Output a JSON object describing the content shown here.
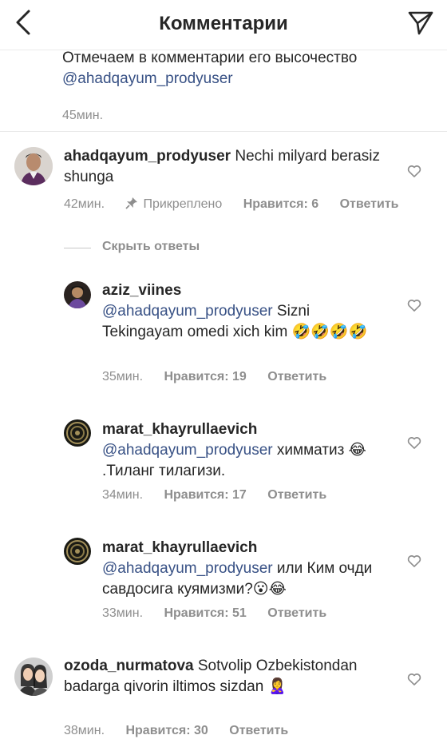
{
  "header": {
    "title": "Комментарии"
  },
  "caption": {
    "text": "Отмечаем в комментарии его высочество",
    "mention": "@ahadqayum_prodyuser",
    "time": "45мин."
  },
  "comments": [
    {
      "username": "ahadqayum_prodyuser",
      "text": " Nechi milyard berasiz shunga",
      "time": "42мин.",
      "pinned": "Прикреплено",
      "likes": "Нравится: 6",
      "reply": "Ответить"
    },
    {
      "username": "ozoda_nurmatova",
      "text": " Sotvolip Ozbekistondan badarga qivorin iltimos sizdan 🙎‍♀️",
      "time": "38мин.",
      "likes": "Нравится: 30",
      "reply": "Ответить"
    }
  ],
  "hide_replies": "Скрыть ответы",
  "replies": [
    {
      "username": "aziz_viines",
      "mention": "@ahadqayum_prodyuser",
      "text": " Sizni Tekingayam omedi xich kim 🤣🤣🤣🤣",
      "time": "35мин.",
      "likes": "Нравится: 19",
      "reply": "Ответить"
    },
    {
      "username": "marat_khayrullaevich",
      "mention": "@ahadqayum_prodyuser",
      "text": " химматиз 😂 .Тиланг тилагизи.",
      "time": "34мин.",
      "likes": "Нравится: 17",
      "reply": "Ответить"
    },
    {
      "username": "marat_khayrullaevich",
      "mention": "@ahadqayum_prodyuser",
      "text": " или Ким очди савдосига куямизми?😮😂",
      "time": "33мин.",
      "likes": "Нравится: 51",
      "reply": "Ответить"
    }
  ],
  "colors": {
    "mention": "#385185",
    "muted": "#8e8e8e",
    "text": "#262626"
  },
  "icons": {
    "back": "chevron-left-icon",
    "send": "paper-plane-icon",
    "like": "heart-outline-icon",
    "pin": "pin-icon"
  }
}
